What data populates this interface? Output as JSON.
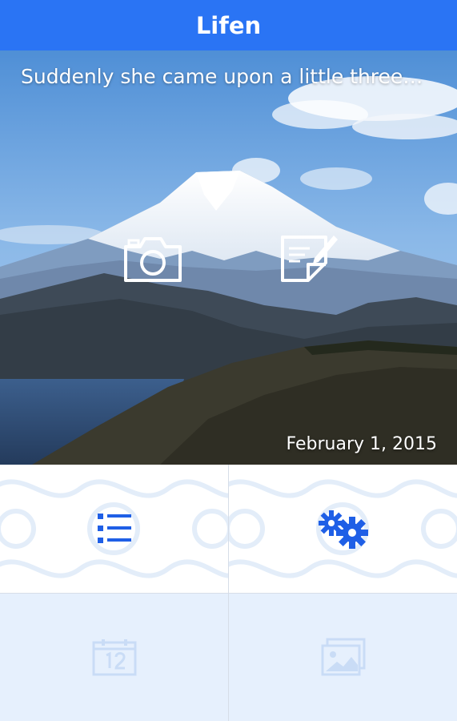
{
  "app": {
    "title": "Lifen"
  },
  "hero": {
    "quote": "Suddenly she came upon a little three…",
    "date": "February 1, 2015",
    "camera_icon": "camera-icon",
    "note_icon": "note-edit-icon"
  },
  "menu": {
    "list_icon": "list-icon",
    "settings_icon": "gears-icon",
    "calendar_icon": "calendar-icon",
    "gallery_icon": "gallery-icon"
  },
  "colors": {
    "accent": "#2a74f4",
    "icon_blue": "#1f5fe6",
    "tile_disabled_bg": "#e6f0fd"
  }
}
